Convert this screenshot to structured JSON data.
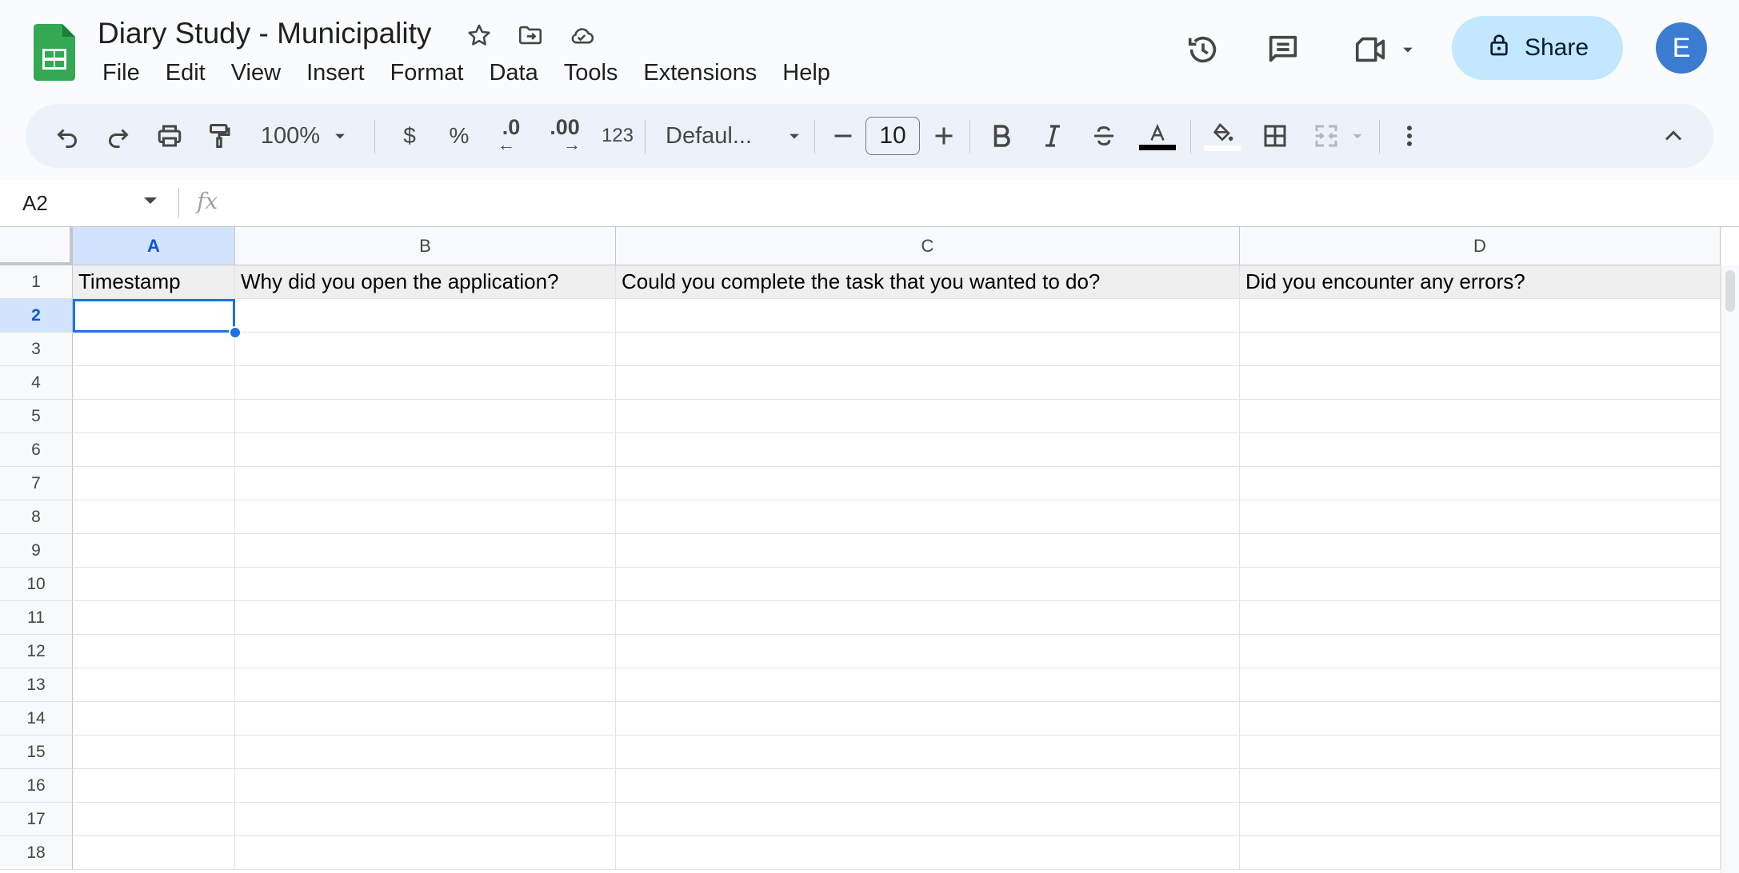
{
  "document": {
    "title": "Diary Study - Municipality",
    "title_icons": [
      "star-icon",
      "move-to-folder-icon",
      "cloud-saved-icon"
    ]
  },
  "menu": [
    "File",
    "Edit",
    "View",
    "Insert",
    "Format",
    "Data",
    "Tools",
    "Extensions",
    "Help"
  ],
  "header_actions": {
    "icons": [
      "version-history-icon",
      "comments-icon",
      "meet-video-icon",
      "dropdown-caret-icon"
    ],
    "share_label": "Share",
    "avatar_initial": "E"
  },
  "toolbar": {
    "zoom": "100%",
    "currency": "$",
    "percent": "%",
    "decrease_decimal": ".0",
    "increase_decimal": ".00",
    "more_formats": "123",
    "font": "Defaul...",
    "font_size": "10",
    "icons": [
      "undo-icon",
      "redo-icon",
      "print-icon",
      "paint-format-icon",
      "bold-icon",
      "italic-icon",
      "strikethrough-icon",
      "text-color-icon",
      "fill-color-icon",
      "borders-icon",
      "merge-cells-icon",
      "more-icon",
      "collapse-toolbar-icon"
    ]
  },
  "formula_bar": {
    "name_box": "A2",
    "fx": "fx",
    "value": ""
  },
  "grid": {
    "columns": [
      "A",
      "B",
      "C",
      "D"
    ],
    "selected_column": "A",
    "rows": [
      "1",
      "2",
      "3",
      "4",
      "5",
      "6",
      "7",
      "8",
      "9",
      "10",
      "11",
      "12",
      "13",
      "14",
      "15",
      "16",
      "17",
      "18"
    ],
    "selected_row": "2",
    "header_cells": [
      "Timestamp",
      "Why did you open the application?",
      "Could you complete the task that you wanted to do?",
      "Did you encounter any errors?"
    ],
    "active_cell": "A2"
  },
  "colors": {
    "accent": "#1a73e8",
    "share_bg": "#c2e7ff",
    "toolbar_bg": "#edf2fa",
    "selected_header_bg": "#d3e3fd",
    "logo_green": "#34a853",
    "avatar_bg": "#3a7cd0"
  }
}
